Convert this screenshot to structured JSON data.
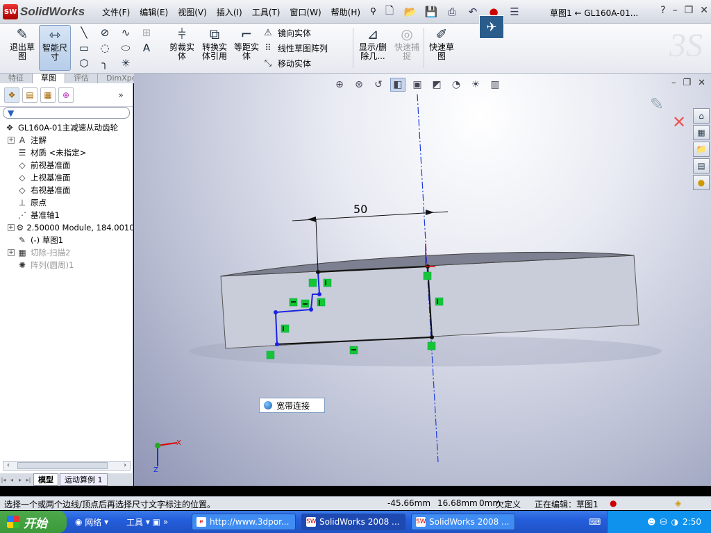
{
  "app": {
    "brand": "SolidWorks",
    "doc_title": "草图1 ← GL160A-01..."
  },
  "menu": [
    "文件(F)",
    "编辑(E)",
    "视图(V)",
    "插入(I)",
    "工具(T)",
    "窗口(W)",
    "帮助(H)"
  ],
  "toolbar": {
    "exit_sketch": "退出草\n图",
    "smart_dim": "智能尺\n寸",
    "trim": "剪裁实\n体",
    "convert": "转换实\n体引用",
    "offset": "等距实\n体",
    "mirror": "镜向实体",
    "linear_pattern": "线性草图阵列",
    "move": "移动实体",
    "display_delete": "显示/删\n除几...",
    "quick_snap": "快速捕\n捉",
    "rapid_sketch": "快速草\n图"
  },
  "cm_tabs": [
    "特征",
    "草图",
    "评估",
    "DimXpert"
  ],
  "filter_icon": "filter-icon",
  "tree": [
    {
      "label": "GL160A-01主减速从动齿轮",
      "icon": "part-icon",
      "expand": false,
      "root": true
    },
    {
      "label": "注解",
      "icon": "annotation-icon",
      "expand": true
    },
    {
      "label": "材质 <未指定>",
      "icon": "material-icon",
      "expand": false
    },
    {
      "label": "前视基准面",
      "icon": "plane-icon",
      "expand": false
    },
    {
      "label": "上视基准面",
      "icon": "plane-icon",
      "expand": false
    },
    {
      "label": "右视基准面",
      "icon": "plane-icon",
      "expand": false
    },
    {
      "label": "原点",
      "icon": "origin-icon",
      "expand": false
    },
    {
      "label": "基准轴1",
      "icon": "axis-icon",
      "expand": false
    },
    {
      "label": "2.50000 Module, 184.0010mm",
      "icon": "gear-icon",
      "expand": true
    },
    {
      "label": "(-) 草图1",
      "icon": "sketch-icon",
      "expand": false
    },
    {
      "label": "切除-扫描2",
      "icon": "cut-icon",
      "expand": true,
      "dim": true
    },
    {
      "label": "阵列(圆周)1",
      "icon": "pattern-icon",
      "expand": false,
      "dim": true
    }
  ],
  "bottom_tabs": [
    "模型",
    "运动算例 1"
  ],
  "viewport": {
    "dimension": "50",
    "tooltip": "宽带连接",
    "axis_x": "X",
    "axis_z": "Z"
  },
  "status": {
    "hint": "选择一个或两个边线/顶点后再选择尺寸文字标注的位置。",
    "x": "-45.66mm",
    "y": "16.68mm",
    "z": "0mm",
    "define": "欠定义",
    "editing": "正在编辑：草图1"
  },
  "taskbar": {
    "start": "开始",
    "network": "网络",
    "tools": "工具",
    "tasks": [
      "http://www.3dpor...",
      "SolidWorks 2008 ...",
      "SolidWorks 2008 ..."
    ],
    "clock": "2:50"
  }
}
